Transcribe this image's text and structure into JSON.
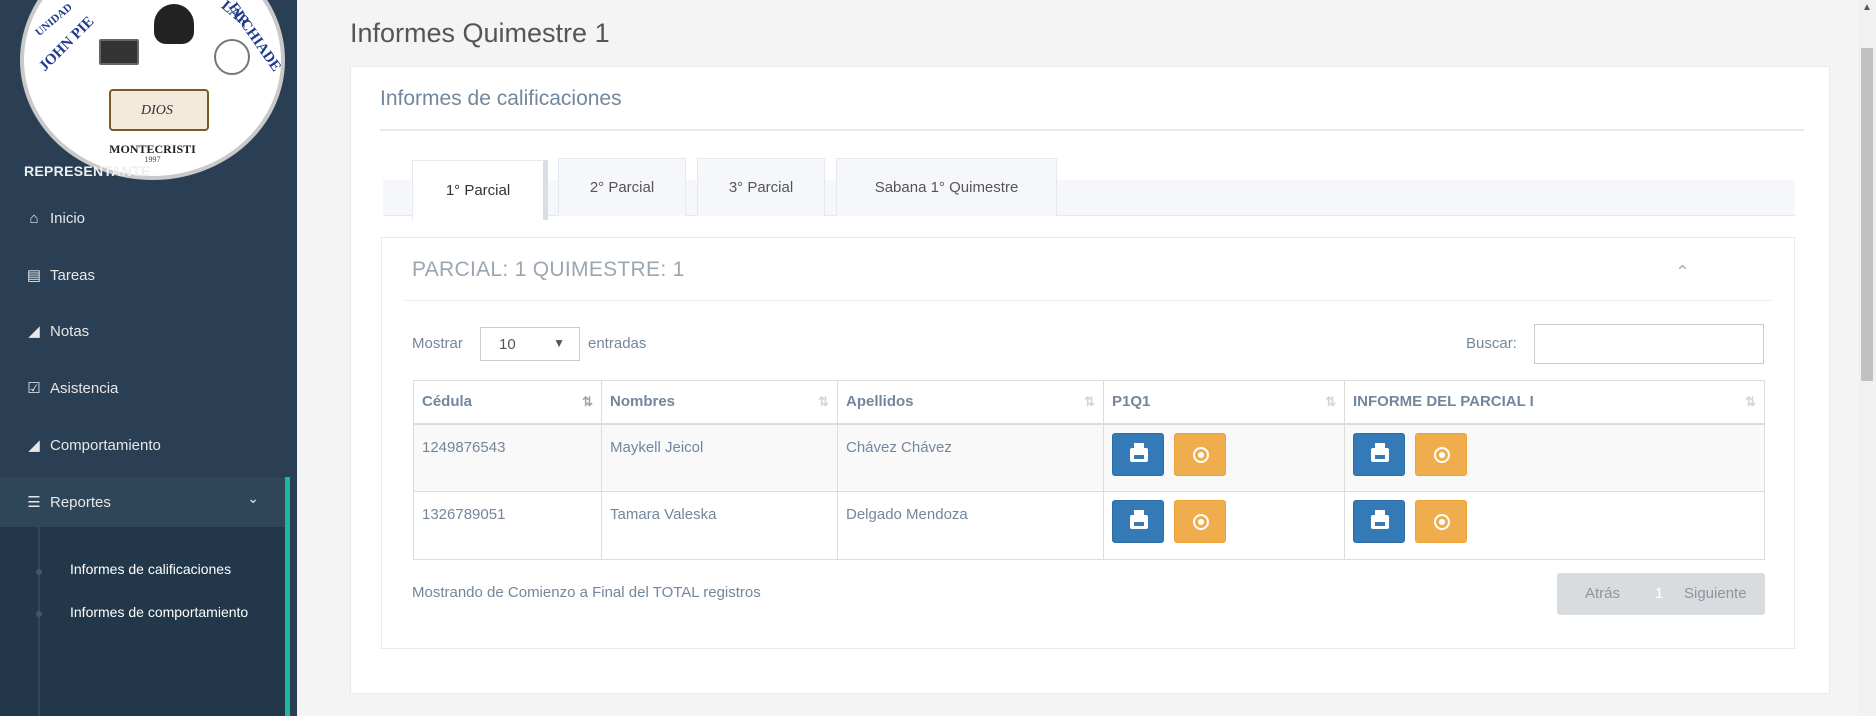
{
  "logo": {
    "ring_left": "UNIDAD",
    "ring_left2": "JOHN PIE",
    "ring_right": "LAR",
    "ring_right2": "ELCHIADE",
    "book_text": "DIOS",
    "bottom_text": "MONTECRISTI",
    "year": "1997"
  },
  "sidebar": {
    "section_title": "REPRESENTANTE",
    "items": [
      {
        "label": "Inicio",
        "icon": "home-icon"
      },
      {
        "label": "Tareas",
        "icon": "list-icon"
      },
      {
        "label": "Notas",
        "icon": "folder-icon"
      },
      {
        "label": "Asistencia",
        "icon": "check-square-icon"
      },
      {
        "label": "Comportamiento",
        "icon": "folder-icon"
      },
      {
        "label": "Reportes",
        "icon": "bars-icon"
      }
    ],
    "submenu": [
      "Informes de calificaciones",
      "Informes de comportamiento"
    ]
  },
  "page": {
    "title": "Informes Quimestre 1",
    "panel_title": "Informes de calificaciones"
  },
  "tabs": [
    "1° Parcial",
    "2° Parcial",
    "3° Parcial",
    "Sabana 1° Quimestre"
  ],
  "inner": {
    "title": "PARCIAL: 1 QUIMESTRE: 1",
    "show_label": "Mostrar",
    "length_value": "10",
    "entries_label": "entradas",
    "search_label": "Buscar:",
    "search_value": ""
  },
  "table": {
    "headers": [
      "Cédula",
      "Nombres",
      "Apellidos",
      "P1Q1",
      "INFORME DEL PARCIAL I"
    ],
    "rows": [
      {
        "cedula": "1249876543",
        "nombres": "Maykell Jeicol",
        "apellidos": "Chávez Chávez"
      },
      {
        "cedula": "1326789051",
        "nombres": "Tamara Valeska",
        "apellidos": "Delgado Mendoza"
      }
    ]
  },
  "footer": {
    "info": "Mostrando de Comienzo a Final del TOTAL registros",
    "prev": "Atrás",
    "page": "1",
    "next": "Siguiente"
  },
  "colors": {
    "sidebar": "#2a3f54",
    "accent": "#1abb9c",
    "print_button": "#337ab7",
    "download_button": "#f0ad4e"
  }
}
